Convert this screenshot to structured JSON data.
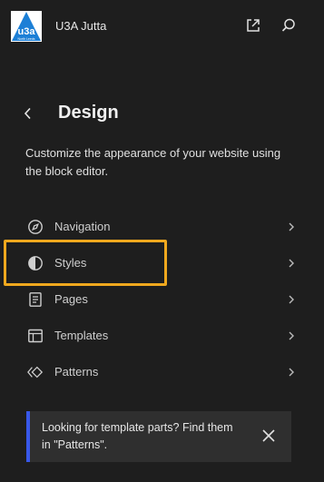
{
  "header": {
    "site_name": "U3A Jutta",
    "logo": {
      "text": "u3a",
      "subtext": "North Leeds",
      "color": "#1c7fd6"
    },
    "external_icon": "external-link-icon",
    "search_icon": "search-icon"
  },
  "panel": {
    "title": "Design",
    "back_icon": "chevron-left-icon",
    "description": "Customize the appearance of your website using the block editor."
  },
  "menu": {
    "items": [
      {
        "label": "Navigation",
        "icon": "navigation-compass-icon"
      },
      {
        "label": "Styles",
        "icon": "styles-half-circle-icon"
      },
      {
        "label": "Pages",
        "icon": "pages-icon"
      },
      {
        "label": "Templates",
        "icon": "templates-layout-icon"
      },
      {
        "label": "Patterns",
        "icon": "patterns-diamond-icon"
      }
    ],
    "highlighted_index": 1,
    "highlight_color": "#f0a81e"
  },
  "notice": {
    "text": "Looking for template parts? Find them in \"Patterns\".",
    "accent_color": "#3858e9",
    "close_icon": "close-icon"
  }
}
